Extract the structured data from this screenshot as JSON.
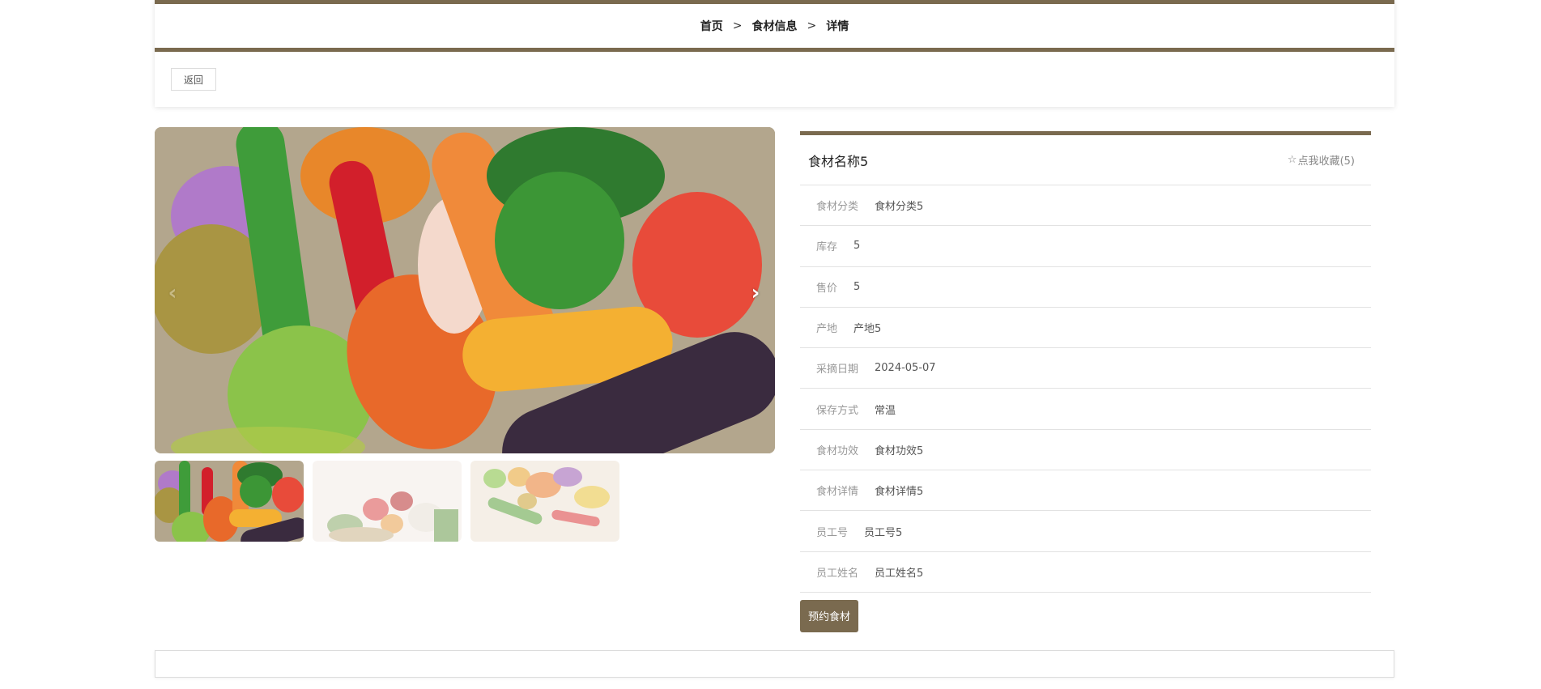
{
  "breadcrumb": {
    "items": [
      "首页",
      "食材信息",
      "详情"
    ],
    "separator": ">"
  },
  "toolbar": {
    "back_label": "返回"
  },
  "gallery": {
    "prev_icon": "chevron-left-icon",
    "next_icon": "chevron-right-icon",
    "thumbnails": [
      "vegetables-thumb-1",
      "vegetables-thumb-2",
      "vegetables-thumb-3"
    ]
  },
  "detail": {
    "title": "食材名称5",
    "favorite_label": "点我收藏(5)",
    "favorite_icon": "star-outline-icon",
    "fields": [
      {
        "label": "食材分类",
        "value": "食材分类5"
      },
      {
        "label": "库存",
        "value": "5"
      },
      {
        "label": "售价",
        "value": "5"
      },
      {
        "label": "产地",
        "value": "产地5"
      },
      {
        "label": "采摘日期",
        "value": "2024-05-07"
      },
      {
        "label": "保存方式",
        "value": "常温"
      },
      {
        "label": "食材功效",
        "value": "食材功效5"
      },
      {
        "label": "食材详情",
        "value": "食材详情5"
      },
      {
        "label": "员工号",
        "value": "员工号5"
      },
      {
        "label": "员工姓名",
        "value": "员工姓名5"
      }
    ],
    "reserve_label": "预约食材"
  },
  "colors": {
    "accent": "#7a6a4f",
    "border": "#e2e2e2"
  }
}
